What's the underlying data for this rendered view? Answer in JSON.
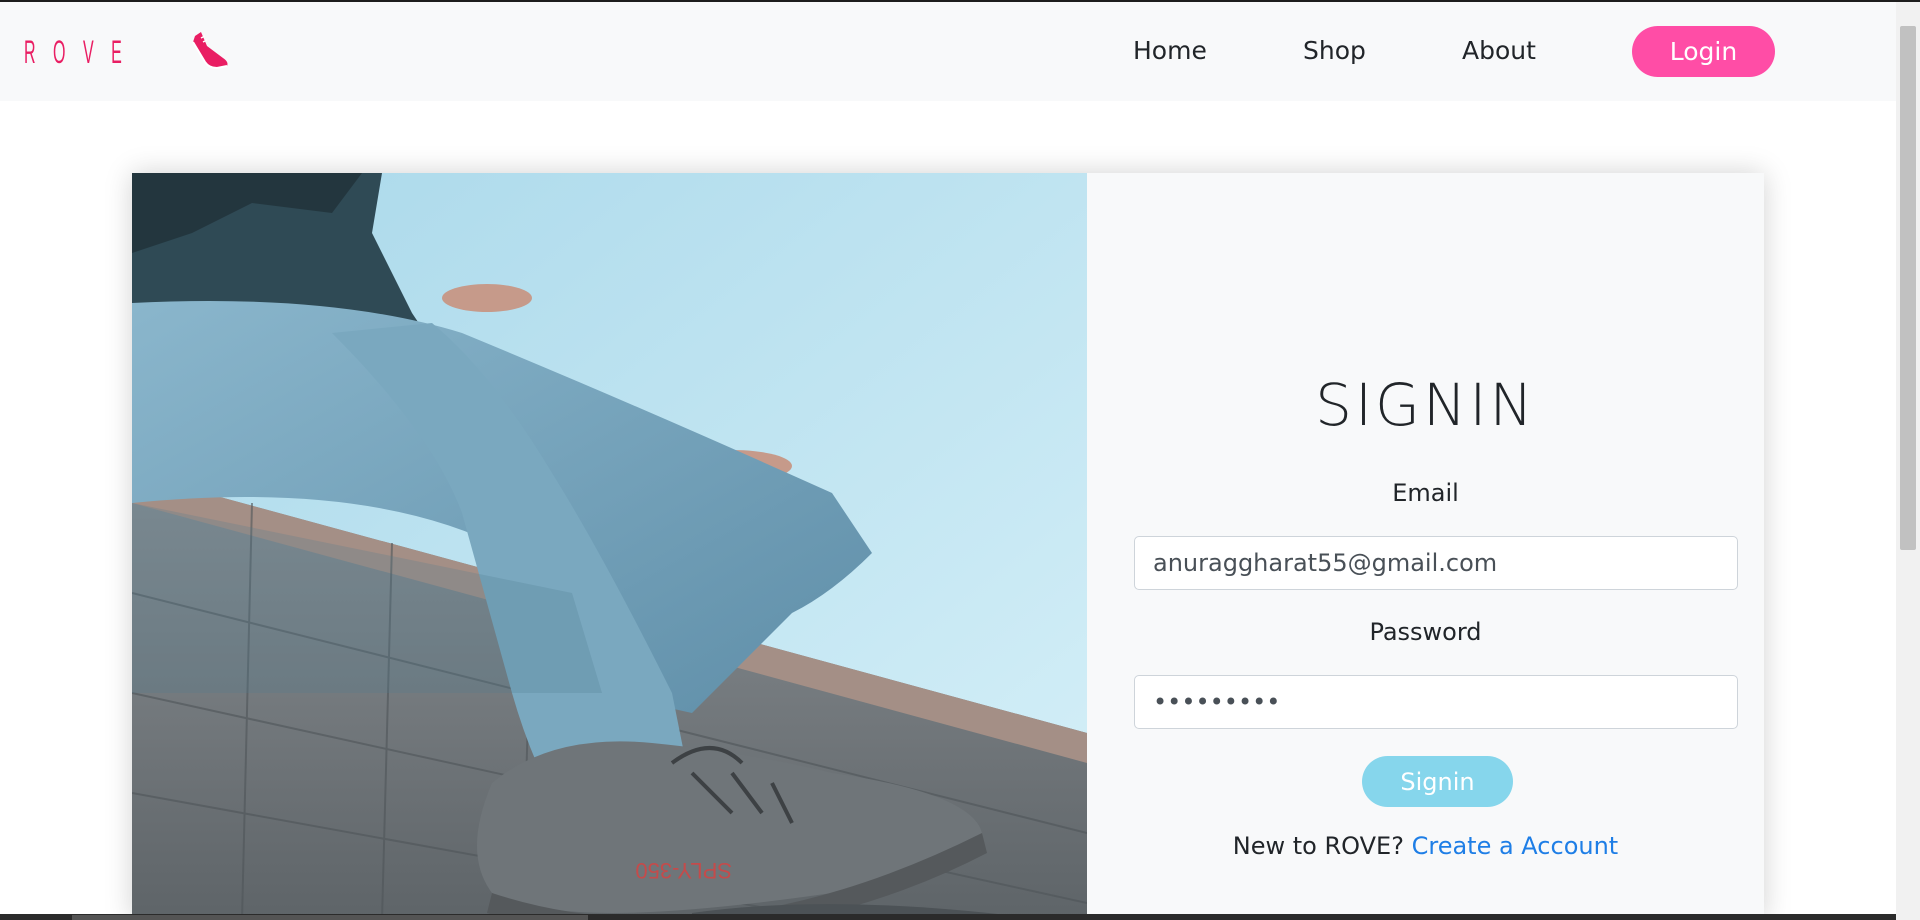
{
  "nav": {
    "brand": "ROVE",
    "brand_icon": "sneaker-icon",
    "links": [
      "Home",
      "Shop",
      "About"
    ],
    "login_label": "Login"
  },
  "colors": {
    "brand": "#e91e63",
    "login_button": "#ff4da6",
    "signin_button": "#86d6ec",
    "link": "#1e7ee6"
  },
  "form": {
    "title": "SIGNIN",
    "email_label": "Email",
    "email_value": "anuraggharat55@gmail.com",
    "password_label": "Password",
    "password_value": "•••••••••",
    "submit_label": "Signin",
    "new_prompt": "New to ROVE?",
    "create_link": "Create a Account"
  },
  "hero_image": "person sitting on wall wearing light jeans and grey sneakers against sky"
}
